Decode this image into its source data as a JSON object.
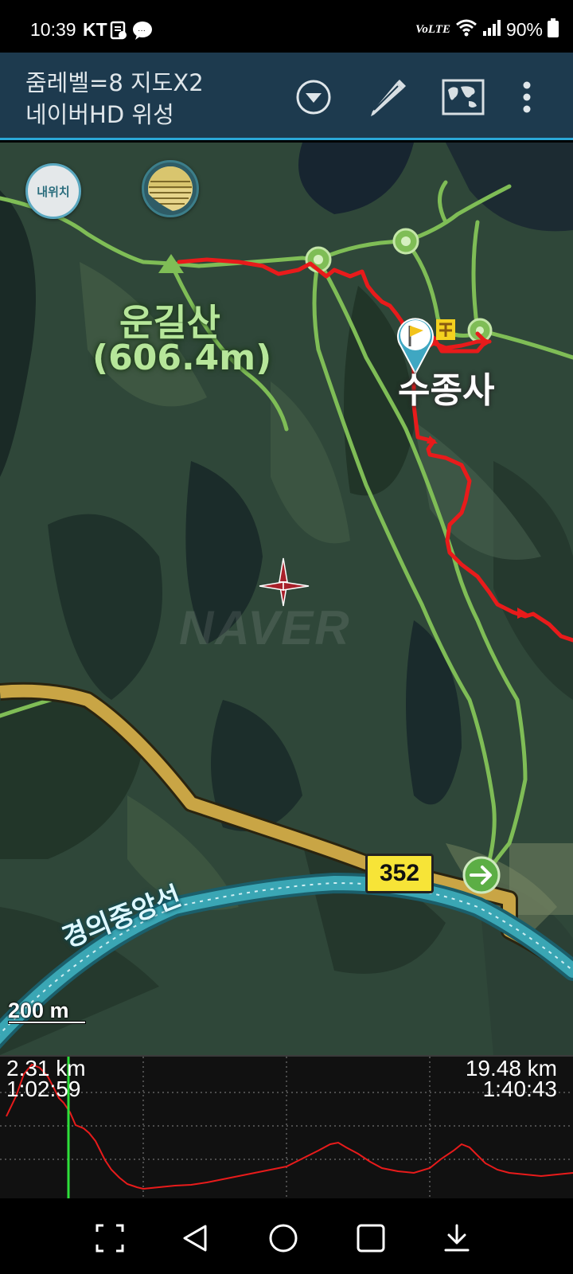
{
  "status_bar": {
    "time": "10:39",
    "carrier": "KT",
    "network": "VoLTE",
    "battery": "90%"
  },
  "app_bar": {
    "title_line1": "줌레벨=8 지도X2",
    "title_line2": "네이버HD 위성",
    "icons": [
      "dropdown-icon",
      "pencil-icon",
      "map-icon",
      "more-vert-icon"
    ]
  },
  "map": {
    "my_location_label": "내위치",
    "peak_name": "운길산",
    "peak_altitude": "(606.4m)",
    "temple_name": "수종사",
    "road_number": "352",
    "rail_line": "경의중앙선",
    "watermark": "NAVER",
    "scale": "200 m",
    "colors": {
      "track": "#e81b1b",
      "trail": "#7fbd56",
      "road": "#c9a545",
      "rail": "#2a8b98"
    }
  },
  "profile": {
    "left_distance": "2.31 km",
    "left_time": "1:02:59",
    "right_distance": "19.48 km",
    "right_time": "1:40:43",
    "cursor_fraction": 0.119
  },
  "nav_bar": {
    "icons": [
      "screenshot-icon",
      "back-icon",
      "home-icon",
      "recents-icon",
      "collapse-icon"
    ]
  }
}
